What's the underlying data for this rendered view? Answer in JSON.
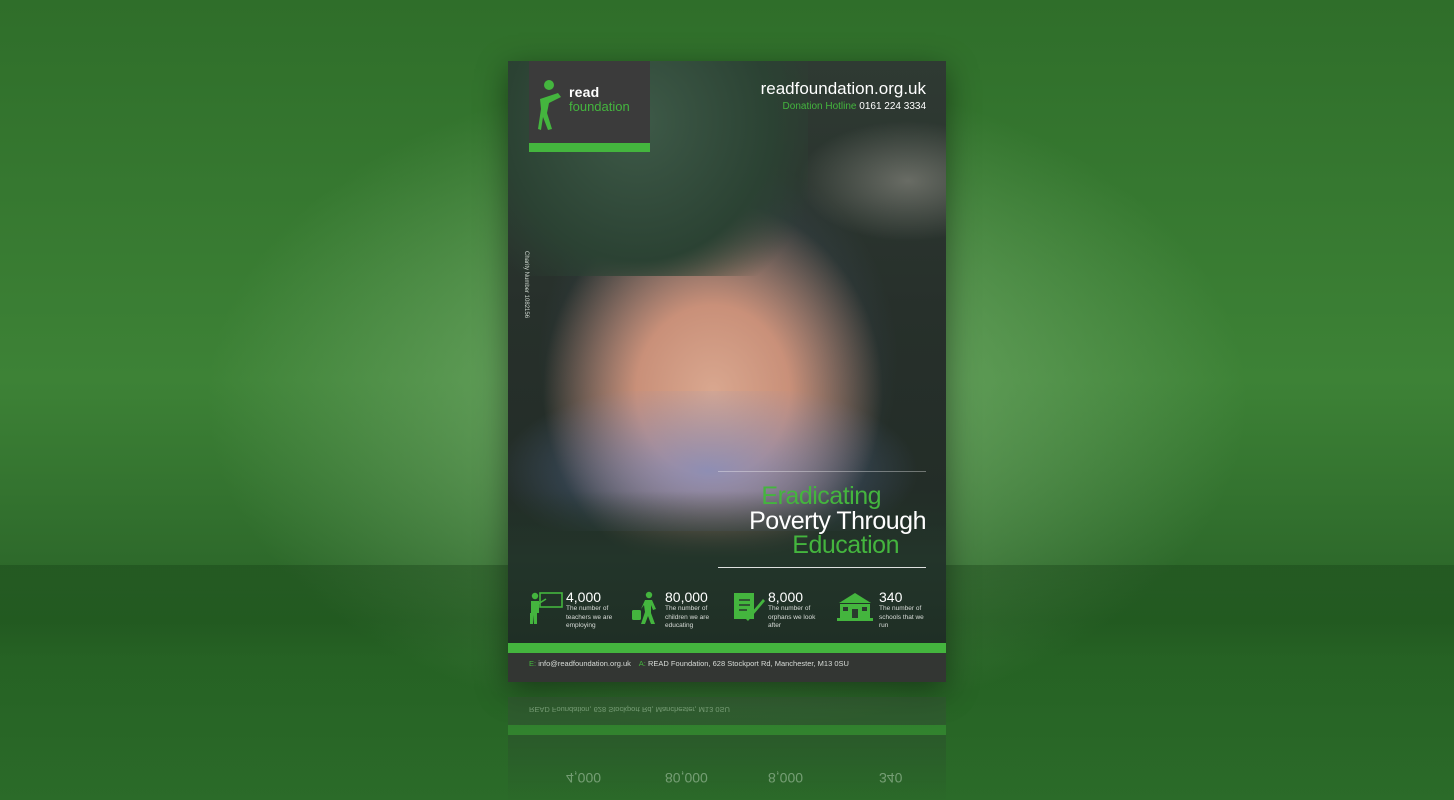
{
  "poster": {
    "logo": {
      "line1": "read",
      "line2": "foundation"
    },
    "website": "readfoundation.org.uk",
    "hotline_label": "Donation Hotline",
    "hotline_number": "0161 224 3334",
    "side_text": "Charity Number 1082156",
    "headline": {
      "line1": "Eradicating",
      "line2": "Poverty Through",
      "line3": "Education"
    },
    "stats": [
      {
        "value": "4,000",
        "desc": "The number of teachers we are employing",
        "icon": "teacher-icon"
      },
      {
        "value": "80,000",
        "desc": "The number of children we are educating",
        "icon": "child-walking-icon"
      },
      {
        "value": "8,000",
        "desc": "The number of orphans we look after",
        "icon": "notebook-icon"
      },
      {
        "value": "340",
        "desc": "The number of schools that we run",
        "icon": "school-building-icon"
      }
    ],
    "footer": {
      "email_label": "E:",
      "email": "info@readfoundation.org.uk",
      "address_label": "A:",
      "address": "READ Foundation, 628 Stockport Rd, Manchester, M13 0SU"
    }
  },
  "colors": {
    "brand_green": "#44b53e",
    "dark": "#333633",
    "background": "#3d8236"
  }
}
